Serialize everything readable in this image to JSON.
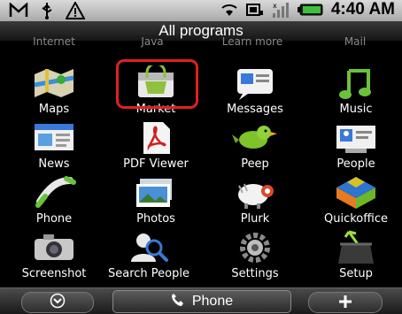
{
  "status_bar": {
    "time": "4:40 AM",
    "left_icons": [
      "gmail-icon",
      "usb-icon",
      "warning-icon"
    ],
    "right_icons": [
      "wifi-icon",
      "sync-icon",
      "signal-icon",
      "battery-icon"
    ]
  },
  "header": {
    "title": "All programs"
  },
  "previous_row": [
    "Internet",
    "Java",
    "Learn more",
    "Mail"
  ],
  "apps": [
    {
      "label": "Maps",
      "icon": "maps-icon"
    },
    {
      "label": "Market",
      "icon": "market-icon"
    },
    {
      "label": "Messages",
      "icon": "messages-icon"
    },
    {
      "label": "Music",
      "icon": "music-icon"
    },
    {
      "label": "News",
      "icon": "news-icon"
    },
    {
      "label": "PDF Viewer",
      "icon": "pdf-icon"
    },
    {
      "label": "Peep",
      "icon": "peep-bird-icon"
    },
    {
      "label": "People",
      "icon": "people-icon"
    },
    {
      "label": "Phone",
      "icon": "phone-icon"
    },
    {
      "label": "Photos",
      "icon": "photos-icon"
    },
    {
      "label": "Plurk",
      "icon": "plurk-icon"
    },
    {
      "label": "Quickoffice",
      "icon": "quickoffice-icon"
    },
    {
      "label": "Screenshot",
      "icon": "camera-icon"
    },
    {
      "label": "Search People",
      "icon": "search-people-icon"
    },
    {
      "label": "Settings",
      "icon": "settings-gear-icon"
    },
    {
      "label": "Setup",
      "icon": "setup-icon"
    }
  ],
  "bottom_bar": {
    "phone_label": "Phone",
    "left_icon": "chevron-down-icon",
    "right_icon": "plus-icon"
  },
  "colors": {
    "highlight": "#e02020",
    "status_bar": "#c0c0c0"
  }
}
